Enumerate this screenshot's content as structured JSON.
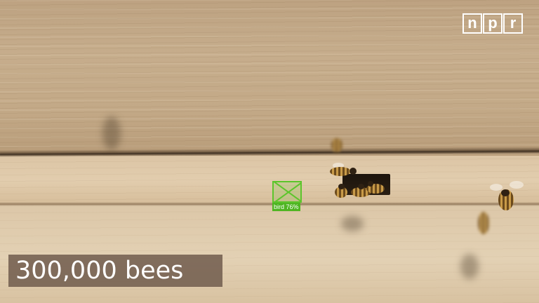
{
  "video": {
    "logo": {
      "letters": [
        "n",
        "p",
        "r"
      ],
      "color": "#ffffff"
    },
    "caption": "300,000 bees",
    "detection": {
      "label": "bird 76%",
      "color": "#5cc52b"
    }
  }
}
